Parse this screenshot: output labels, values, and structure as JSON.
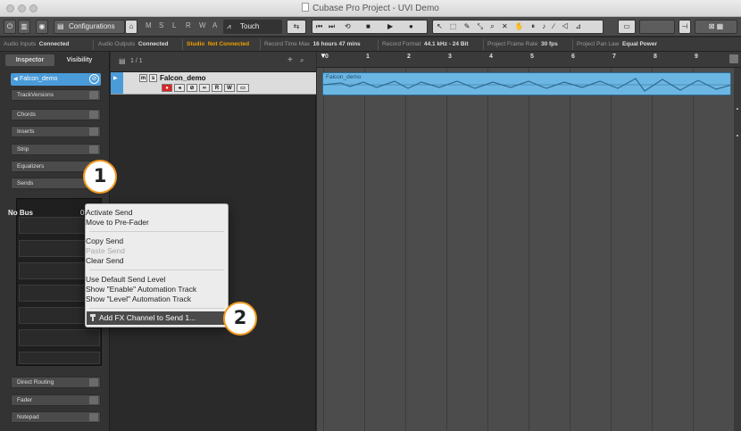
{
  "window": {
    "title": "Cubase Pro Project - UVI Demo"
  },
  "toolbar": {
    "configurations_label": "Configurations",
    "touch_label": "Touch",
    "letters": [
      "M",
      "S",
      "L",
      "R",
      "W",
      "A"
    ]
  },
  "status_bar": {
    "audio_inputs_label": "Audio Inputs",
    "audio_inputs_value": "Connected",
    "audio_outputs_label": "Audio Outputs",
    "audio_outputs_value": "Connected",
    "studio_label": "Studio",
    "studio_value": "Not Connected",
    "record_time_label": "Record Time Max",
    "record_time_value": "16 hours 47 mins",
    "record_format_label": "Record Format",
    "record_format_value": "44.1 kHz - 24 Bit",
    "frame_rate_label": "Project Frame Rate",
    "frame_rate_value": "30 fps",
    "pan_law_label": "Project Pan Law",
    "pan_law_value": "Equal Power"
  },
  "inspector": {
    "tabs": [
      "Inspector",
      "Visibility"
    ],
    "track_name": "Falcon_demo",
    "sections_top": [
      "TrackVersions",
      "Chords",
      "Inserts",
      "Strip",
      "Equalizers",
      "Sends"
    ],
    "sends_bus_label": "No Bus",
    "sends_bus_value": "0",
    "sections_bottom": [
      "Direct Routing",
      "Fader",
      "Notepad"
    ]
  },
  "tracklist": {
    "count_label": "1 / 1",
    "track_name": "Falcon_demo",
    "buttons": [
      "m",
      "s",
      "R",
      "W"
    ]
  },
  "ruler": {
    "bars": [
      "0",
      "1",
      "2",
      "3",
      "4",
      "5",
      "6",
      "7",
      "8",
      "9"
    ]
  },
  "event": {
    "name": "Falcon_demo"
  },
  "context_menu": {
    "items": [
      {
        "label": "Activate Send",
        "enabled": true
      },
      {
        "label": "Move to Pre-Fader",
        "enabled": true
      },
      {
        "label": "Copy Send",
        "enabled": true
      },
      {
        "label": "Paste Send",
        "enabled": false
      },
      {
        "label": "Clear Send",
        "enabled": true
      },
      {
        "label": "Use Default Send Level",
        "enabled": true
      },
      {
        "label": "Show \"Enable\" Automation Track",
        "enabled": true
      },
      {
        "label": "Show \"Level\" Automation Track",
        "enabled": true
      }
    ],
    "highlighted_item": "Add FX Channel to Send 1..."
  },
  "callouts": [
    "1",
    "2"
  ],
  "colors": {
    "accent": "#4a9bd9",
    "callout_border": "#f39a1e",
    "event_fill": "#6cb6e3",
    "warning": "#f0a000"
  }
}
